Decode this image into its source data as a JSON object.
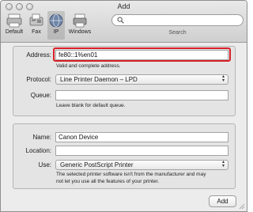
{
  "window": {
    "title": "Add"
  },
  "toolbar": {
    "items": [
      {
        "label": "Default",
        "icon": "default-printer-icon"
      },
      {
        "label": "Fax",
        "icon": "fax-icon"
      },
      {
        "label": "IP",
        "icon": "ip-globe-icon",
        "selected": true
      },
      {
        "label": "Windows",
        "icon": "windows-printer-icon"
      }
    ],
    "search": {
      "placeholder": "",
      "caption": "Search"
    }
  },
  "connection": {
    "address_label": "Address:",
    "address_value": "fe80::1%en01",
    "address_hint": "Valid and complete address.",
    "protocol_label": "Protocol:",
    "protocol_value": "Line Printer Daemon – LPD",
    "queue_label": "Queue:",
    "queue_value": "",
    "queue_hint": "Leave blank for default queue."
  },
  "details": {
    "name_label": "Name:",
    "name_value": "Canon Device",
    "location_label": "Location:",
    "location_value": "",
    "use_label": "Use:",
    "use_value": "Generic PostScript Printer",
    "use_hint_line1": "The selected printer software isn't from the manufacturer and may",
    "use_hint_line2": "not let you use all the features of your printer."
  },
  "actions": {
    "add_label": "Add"
  },
  "colors": {
    "highlight": "#d81f26"
  }
}
